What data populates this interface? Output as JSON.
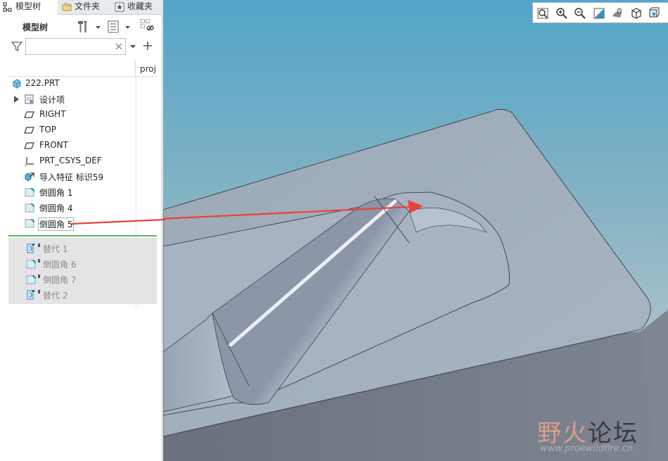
{
  "tabs": [
    {
      "label": "模型树",
      "icon": "model-tree-icon"
    },
    {
      "label": "文件夹",
      "icon": "folder-icon"
    },
    {
      "label": "收藏夹",
      "icon": "favorites-icon"
    }
  ],
  "panel": {
    "title": "模型树",
    "search": {
      "value": "",
      "placeholder": ""
    },
    "column_header": "proj"
  },
  "tree": {
    "root": "222.PRT",
    "items": [
      {
        "label": "设计项",
        "icon": "design-items-icon",
        "expandable": true
      },
      {
        "label": "RIGHT",
        "icon": "datum-plane-icon"
      },
      {
        "label": "TOP",
        "icon": "datum-plane-icon"
      },
      {
        "label": "FRONT",
        "icon": "datum-plane-icon"
      },
      {
        "label": "PRT_CSYS_DEF",
        "icon": "coordinate-system-icon"
      },
      {
        "label": "导入特征 标识59",
        "icon": "import-feature-icon"
      },
      {
        "label": "倒圆角 1",
        "icon": "round-icon"
      },
      {
        "label": "倒圆角 4",
        "icon": "round-icon"
      },
      {
        "label": "倒圆角 5",
        "icon": "round-icon"
      }
    ],
    "suppressed_items": [
      {
        "label": "替代 1",
        "icon": "replace-icon"
      },
      {
        "label": "倒圆角 6",
        "icon": "round-icon"
      },
      {
        "label": "倒圆角 7",
        "icon": "round-icon"
      },
      {
        "label": "替代 2",
        "icon": "replace-icon"
      }
    ]
  },
  "view_toolbar": [
    {
      "name": "refit-icon"
    },
    {
      "name": "zoom-in-icon"
    },
    {
      "name": "zoom-out-icon"
    },
    {
      "name": "repaint-icon"
    },
    {
      "name": "display-style-icon"
    },
    {
      "name": "saved-views-icon"
    },
    {
      "name": "view-orientation-icon"
    },
    {
      "name": "more-icon"
    }
  ],
  "watermark": {
    "text_colored": "野火",
    "text_dark": "论坛",
    "url": "www.proewildfire.cn"
  },
  "colors": {
    "accent": "#5cb85c",
    "viewport_top": "#52a5c9",
    "annotation_arrow": "#e8423a"
  }
}
